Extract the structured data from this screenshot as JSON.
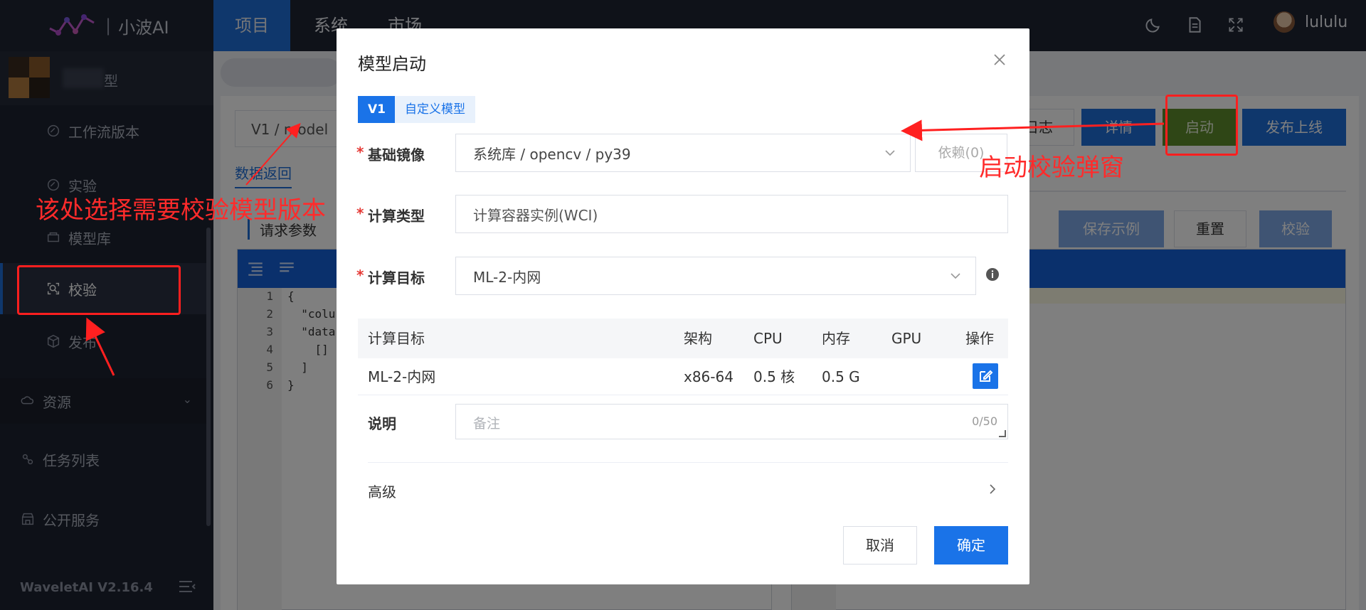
{
  "topbar": {
    "logo_text": "小波AI",
    "logo_sep": "|",
    "tabs": [
      {
        "label": "项目",
        "active": true
      },
      {
        "label": "系统",
        "active": false
      },
      {
        "label": "市场",
        "active": false
      }
    ],
    "icons": [
      "moon-icon",
      "document-icon",
      "fullscreen-icon"
    ],
    "username": "lululu"
  },
  "sidebar": {
    "project_suffix": "型",
    "sub_items": [
      {
        "label": "工作流版本",
        "icon": "workflow-icon",
        "active": false
      },
      {
        "label": "实验",
        "icon": "experiment-icon",
        "active": false
      },
      {
        "label": "模型库",
        "icon": "model-library-icon",
        "active": false
      },
      {
        "label": "校验",
        "icon": "verify-icon",
        "active": true
      },
      {
        "label": "发布",
        "icon": "publish-icon",
        "active": false
      }
    ],
    "main_items": [
      {
        "label": "资源",
        "icon": "resource-icon",
        "has_chevron": true
      },
      {
        "label": "任务列表",
        "icon": "task-list-icon",
        "has_chevron": false
      },
      {
        "label": "公开服务",
        "icon": "public-service-icon",
        "has_chevron": false
      }
    ],
    "version": "WaveletAI V2.16.4"
  },
  "background": {
    "model_select": "V1 / model",
    "data_return_link": "数据返回",
    "request_params": "请求参数",
    "log_btn": "日志",
    "detail_btn": "详情",
    "launch_btn": "启动",
    "publish_btn": "发布上线",
    "save_example_btn": "保存示例",
    "reset_btn": "重置",
    "verify_btn": "校验",
    "code_lines": [
      {
        "n": "1",
        "text": "{"
      },
      {
        "n": "2",
        "text": "  \"colu"
      },
      {
        "n": "3",
        "text": "  \"data"
      },
      {
        "n": "4",
        "text": "    []"
      },
      {
        "n": "5",
        "text": "  ]"
      },
      {
        "n": "6",
        "text": "}"
      }
    ]
  },
  "modal": {
    "title": "模型启动",
    "version_tags": [
      "V1",
      "自定义模型"
    ],
    "base_image_label": "基础镜像",
    "base_image_value": "系统库 / opencv / py39",
    "deps_label": "依赖(0)",
    "compute_type_label": "计算类型",
    "compute_type_placeholder": "计算容器实例(WCI)",
    "compute_target_label": "计算目标",
    "compute_target_value": "ML-2-内网",
    "table": {
      "headers": [
        "计算目标",
        "架构",
        "CPU",
        "内存",
        "GPU",
        "操作"
      ],
      "rows": [
        [
          "ML-2-内网",
          "x86-64",
          "0.5 核",
          "0.5 G",
          ""
        ]
      ]
    },
    "remark_label": "说明",
    "remark_placeholder": "备注",
    "remark_count": "0/50",
    "advanced_label": "高级",
    "cancel_btn": "取消",
    "ok_btn": "确定"
  },
  "annotations": {
    "left_note": "该处选择需要校验模型版本",
    "right_note": "启动校验弹窗",
    "color": "#ff2b2b"
  },
  "colors": {
    "topbar_bg": "#1f2533",
    "sidebar_bg": "#1d2230",
    "primary": "#1a73e8",
    "launch_green": "#5e8c2c"
  }
}
